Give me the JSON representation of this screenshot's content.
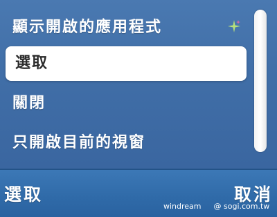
{
  "menu": {
    "items": [
      {
        "label": "顯示開啟的應用程式"
      },
      {
        "label": "選取"
      },
      {
        "label": "關閉"
      },
      {
        "label": "只開啟目前的視窗"
      }
    ],
    "selected_index": 1,
    "status_icon": "sparkle-icon"
  },
  "softkeys": {
    "left": "選取",
    "right": "取消"
  },
  "watermark": {
    "left": "windream",
    "right": "@ sogi.com.tw"
  },
  "colors": {
    "background": "#3f6ea7",
    "selected_bg": "#ffffff",
    "text": "#ffffff"
  }
}
